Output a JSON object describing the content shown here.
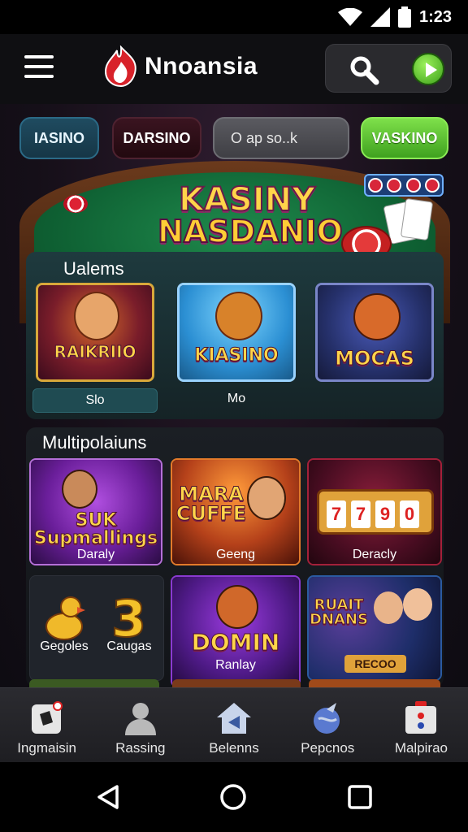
{
  "status_bar": {
    "time": "1:23"
  },
  "app_bar": {
    "title": "Nnoansia"
  },
  "tabs": [
    {
      "label": "IASINO"
    },
    {
      "label": "DARSINO"
    },
    {
      "label": "VASKINO"
    }
  ],
  "search": {
    "placeholder": "O ap so..k"
  },
  "banner": {
    "title_line1": "KASINY",
    "title_line2": "NASDANIO"
  },
  "section1": {
    "title": "Ualems",
    "tiles": [
      {
        "title": "RAIKRIIO"
      },
      {
        "title": "KIASINO"
      },
      {
        "title": "MOCAS"
      }
    ],
    "labels": [
      "Slo",
      "Mo"
    ]
  },
  "section2": {
    "title": "Multipolaiuns",
    "tiles": [
      {
        "title": "SUK\nSupmallings",
        "label": "Daraly"
      },
      {
        "title": "MARA\nCUFFE",
        "label": "Geeng"
      },
      {
        "title": "7 7 9 0",
        "label": "Deracly"
      },
      {
        "title": "",
        "label_left": "Gegoles",
        "label_right": "Caugas"
      },
      {
        "title": "DOMIN",
        "label": "Ranlay"
      },
      {
        "title": "RUAIT\nDNANS",
        "label": "RECOO"
      }
    ]
  },
  "bottom_nav": [
    {
      "label": "Ingmaisin",
      "icon": "dice-icon"
    },
    {
      "label": "Rassing",
      "icon": "user-icon"
    },
    {
      "label": "Belenns",
      "icon": "home-icon"
    },
    {
      "label": "Pepcnos",
      "icon": "globe-icon"
    },
    {
      "label": "Malpirao",
      "icon": "briefcase-icon"
    }
  ],
  "colors": {
    "accent_green": "#55c62a",
    "accent_blue": "#2b6a86",
    "gold": "#ffd54a"
  }
}
